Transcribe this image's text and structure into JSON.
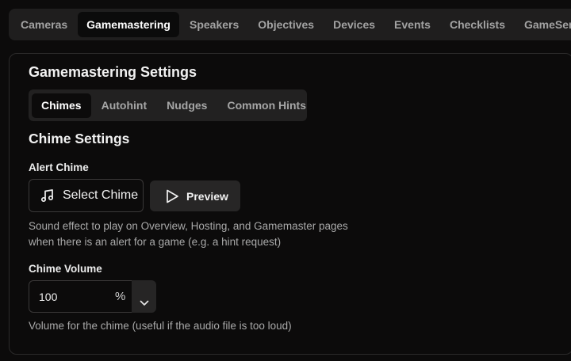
{
  "top_tabs": [
    {
      "label": "Cameras"
    },
    {
      "label": "Gamemastering",
      "active": true
    },
    {
      "label": "Speakers"
    },
    {
      "label": "Objectives"
    },
    {
      "label": "Devices"
    },
    {
      "label": "Events"
    },
    {
      "label": "Checklists"
    },
    {
      "label": "GameSense"
    }
  ],
  "panel": {
    "title": "Gamemastering Settings",
    "sub_tabs": [
      {
        "label": "Chimes",
        "active": true
      },
      {
        "label": "Autohint"
      },
      {
        "label": "Nudges"
      },
      {
        "label": "Common Hints"
      }
    ],
    "section_title": "Chime Settings",
    "alert_chime": {
      "label": "Alert Chime",
      "select_label": "Select Chime",
      "select_icon": "music-note-icon",
      "preview_label": "Preview",
      "preview_icon": "play-icon",
      "help_line1": "Sound effect to play on Overview, Hosting, and Gamemaster pages",
      "help_line2": "when there is an alert for a game (e.g. a hint request)"
    },
    "chime_volume": {
      "label": "Chime Volume",
      "value": "100",
      "unit": "%",
      "stepper_icon": "chevron-down-icon",
      "help": "Volume for the chime (useful if the audio file is too loud)"
    }
  },
  "colors": {
    "background": "#0c0b0b",
    "tabbar": "#1f1e1e",
    "active_tab": "#0b0b0b",
    "muted_text": "#a9a9a9"
  }
}
